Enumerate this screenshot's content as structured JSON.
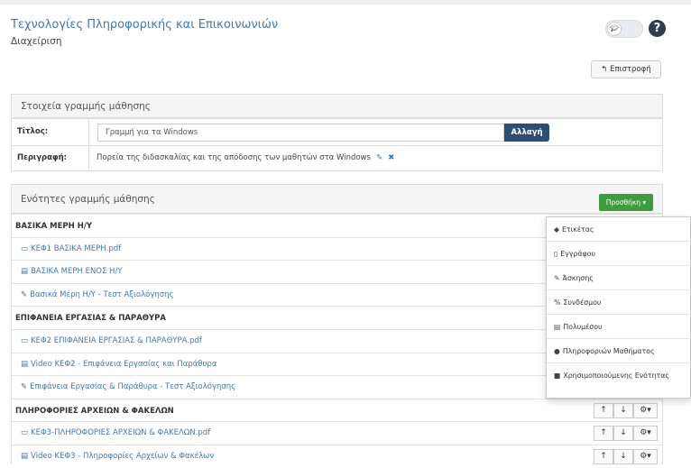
{
  "header": {
    "course_title": "Τεχνολογίες Πληροφορικής και Επικοινωνιών",
    "subtitle": "Διαχείριση",
    "back_label": "Επιστροφή",
    "help_icon": "?"
  },
  "details": {
    "heading": "Στοιχεία γραμμής μάθησης",
    "title_label": "Τίτλος:",
    "title_value": "Γραμμή για τα Windows",
    "change_label": "Αλλαγή",
    "description_label": "Περιγραφή:",
    "description_value": "Πορεία της διδασκαλίας και της απόδοσης των μαθητών στα Windows"
  },
  "units": {
    "heading": "Ενότητες γραμμής μάθησης",
    "add_label": "Προσθήκη ▾",
    "rows": [
      {
        "kind": "section",
        "text": "ΒΑΣΙΚΑ ΜΕΡΗ Η/Υ"
      },
      {
        "kind": "item",
        "icon": "folder-icon",
        "glyph": "▭",
        "text": "ΚΕΦ1 ΒΑΣΙΚΑ ΜΕΡΗ.pdf"
      },
      {
        "kind": "item",
        "icon": "film-icon",
        "glyph": "▤",
        "text": "ΒΑΣΙΚΑ ΜΕΡΗ ΕΝΟΣ Η/Υ"
      },
      {
        "kind": "item",
        "icon": "edit-icon",
        "glyph": "✎",
        "text": "Βασικά Μέρη Η/Υ - Τεστ Αξιολόγησης"
      },
      {
        "kind": "section",
        "text": "ΕΠΙΦΑΝΕΙΑ ΕΡΓΑΣΙΑΣ & ΠΑΡΑΘΥΡΑ"
      },
      {
        "kind": "item",
        "icon": "folder-icon",
        "glyph": "▭",
        "text": "ΚΕΦ2 ΕΠΙΦΑΝΕΙΑ ΕΡΓΑΣΙΑΣ & ΠΑΡΑΘΥΡΑ.pdf"
      },
      {
        "kind": "item",
        "icon": "film-icon",
        "glyph": "▤",
        "text": "Video ΚΕΦ2 - Επιφάνεια Εργασίας και Παράθυρα"
      },
      {
        "kind": "item",
        "icon": "edit-icon",
        "glyph": "✎",
        "text": "Επιφάνεια Εργασίας & Παράθυρα - Τεστ Αξιολόγησης"
      },
      {
        "kind": "section",
        "text": "ΠΛΗΡΟΦΟΡΙΕΣ ΑΡΧΕΙΩΝ & ΦΑΚΕΛΩΝ",
        "controls": true
      },
      {
        "kind": "item",
        "icon": "folder-icon",
        "glyph": "▭",
        "text": "ΚΕΦ3-ΠΛΗΡΟΦΟΡΙΕΣ ΑΡΧΕΙΩΝ & ΦΑΚΕΛΩΝ.pdf",
        "controls": true
      },
      {
        "kind": "item",
        "icon": "film-icon",
        "glyph": "▤",
        "text": "Video ΚΕΦ3 - Πληροφορίες Αρχείων & Φακέλων",
        "controls": true
      }
    ],
    "controls": {
      "up": "↑",
      "down": "↓",
      "gear": "⚙▾"
    }
  },
  "add_menu": {
    "items": [
      {
        "icon": "tag-icon",
        "glyph": "◆",
        "text": "Ετικέτας"
      },
      {
        "icon": "file-icon",
        "glyph": "▯",
        "text": "Εγγράφου"
      },
      {
        "icon": "edit-icon",
        "glyph": "✎",
        "text": "Άσκησης"
      },
      {
        "icon": "link-icon",
        "glyph": "%",
        "text": "Συνδέσμου"
      },
      {
        "icon": "film-icon",
        "glyph": "▤",
        "text": "Πολυμέσου"
      },
      {
        "icon": "info-icon",
        "glyph": "●",
        "text": "Πληροφοριών Μαθήματος"
      },
      {
        "icon": "plus-square-icon",
        "glyph": "■",
        "text": "Χρησιμοποιούμενης Ενότητας"
      }
    ]
  }
}
